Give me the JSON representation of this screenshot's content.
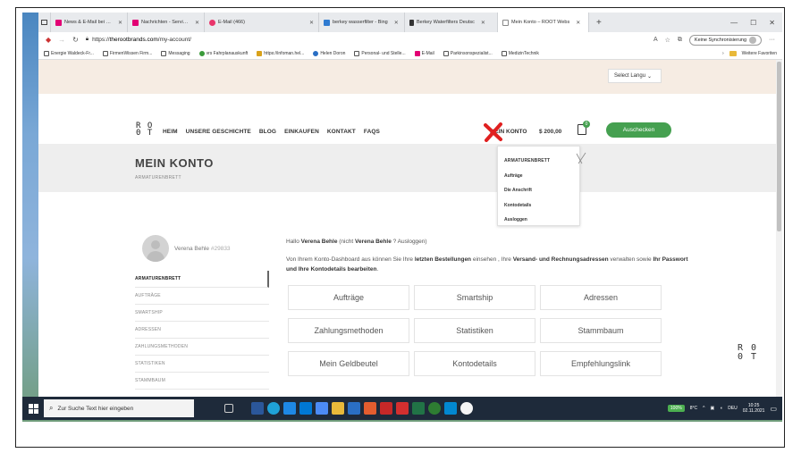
{
  "browser": {
    "tabs": [
      {
        "title": "News & E-Mail bei t-online",
        "favicon_color": "#e20074",
        "active": false
      },
      {
        "title": "Nachrichten - Service - Sh",
        "favicon_color": "#e20074",
        "active": false
      },
      {
        "title": "E-Mail (466)",
        "favicon_color": "#e9356b",
        "active": false
      },
      {
        "title": "berkey wasserfilter - Bing",
        "favicon_color": "#2f7bd1",
        "active": false
      },
      {
        "title": "Berkey Waterfilters Deutsc",
        "favicon_color": "#333333",
        "active": false
      },
      {
        "title": "Mein Konto – ROOT Webs",
        "favicon_color": "#444444",
        "active": true
      }
    ],
    "new_tab": "+",
    "window_controls": {
      "minimize": "—",
      "maximize": "☐",
      "close": "✕"
    },
    "url_prefix": "https://",
    "url_domain": "therootbrands.com",
    "url_path": "/my-account/",
    "sync_label": "Keine Synchronisierung",
    "more_icon": "···",
    "bookmarks": [
      "Energie Waldeck-Fr...",
      "FirmenWissen Firm...",
      "Messaging",
      "vrs Fahrplanauskunft",
      "https://infoman.hel...",
      "Helen Doron",
      "Personal- und Stelle...",
      "E-Mail",
      "Parkinsonspezialist...",
      "MedizinTechnik"
    ],
    "bookmarks_more": "Weitere Favoriten"
  },
  "site": {
    "language_select": "Select Langu",
    "logo_top": "R O",
    "logo_bottom": "0 T",
    "nav": [
      "HEIM",
      "UNSERE GESCHICHTE",
      "BLOG",
      "EINKAUFEN",
      "KONTAKT",
      "FAQS"
    ],
    "account_link": "MEIN KONTO",
    "cart_total": "$ 200,00",
    "cart_count": "0",
    "checkout_button": "Auschecken",
    "dropdown": [
      "ARMATURENBRETT",
      "Aufträge",
      "Die Anschrift",
      "Kontodetails",
      "Ausloggen"
    ],
    "page_title": "MEIN KONTO",
    "breadcrumb": "ARMATURENBRETT",
    "user_name": "Verena Behle",
    "user_id": "#29833",
    "side_menu": [
      "ARMATURENBRETT",
      "AUFTRÄGE",
      "SMARTSHIP",
      "ADRESSEN",
      "ZAHLUNGSMETHODEN",
      "STATISTIKEN",
      "STAMMBAUM"
    ],
    "greeting_prefix": "Hallo",
    "greeting_name": "Verena Behle",
    "greeting_mid": "(nicht",
    "greeting_name2": "Verena Behle",
    "greeting_logout": "? Ausloggen",
    "greeting_end": ")",
    "intro_1": "Von Ihrem Konto-Dashboard aus können Sie Ihre",
    "intro_bold1": "letzten Bestellungen",
    "intro_2": "einsehen , Ihre",
    "intro_bold2": "Versand- und Rechnungsadressen",
    "intro_3": "verwalten sowie",
    "intro_bold3": "Ihr Passwort und Ihre Kontodetails bearbeiten",
    "intro_4": ".",
    "tiles": [
      "Aufträge",
      "Smartship",
      "Adressen",
      "Zahlungsmethoden",
      "Statistiken",
      "Stammbaum",
      "Mein Geldbeutel",
      "Kontodetails",
      "Empfehlungslink"
    ],
    "root_side_top": "R 0",
    "root_side_bottom": "0 T"
  },
  "taskbar": {
    "search_placeholder": "Zur Suche Text hier eingeben",
    "battery": "100%",
    "temp": "8°C",
    "lang": "DEU",
    "time": "10:25",
    "date": "02.11.2021"
  },
  "colors": {
    "accent_green": "#45a050",
    "red_mark": "#e02020"
  }
}
